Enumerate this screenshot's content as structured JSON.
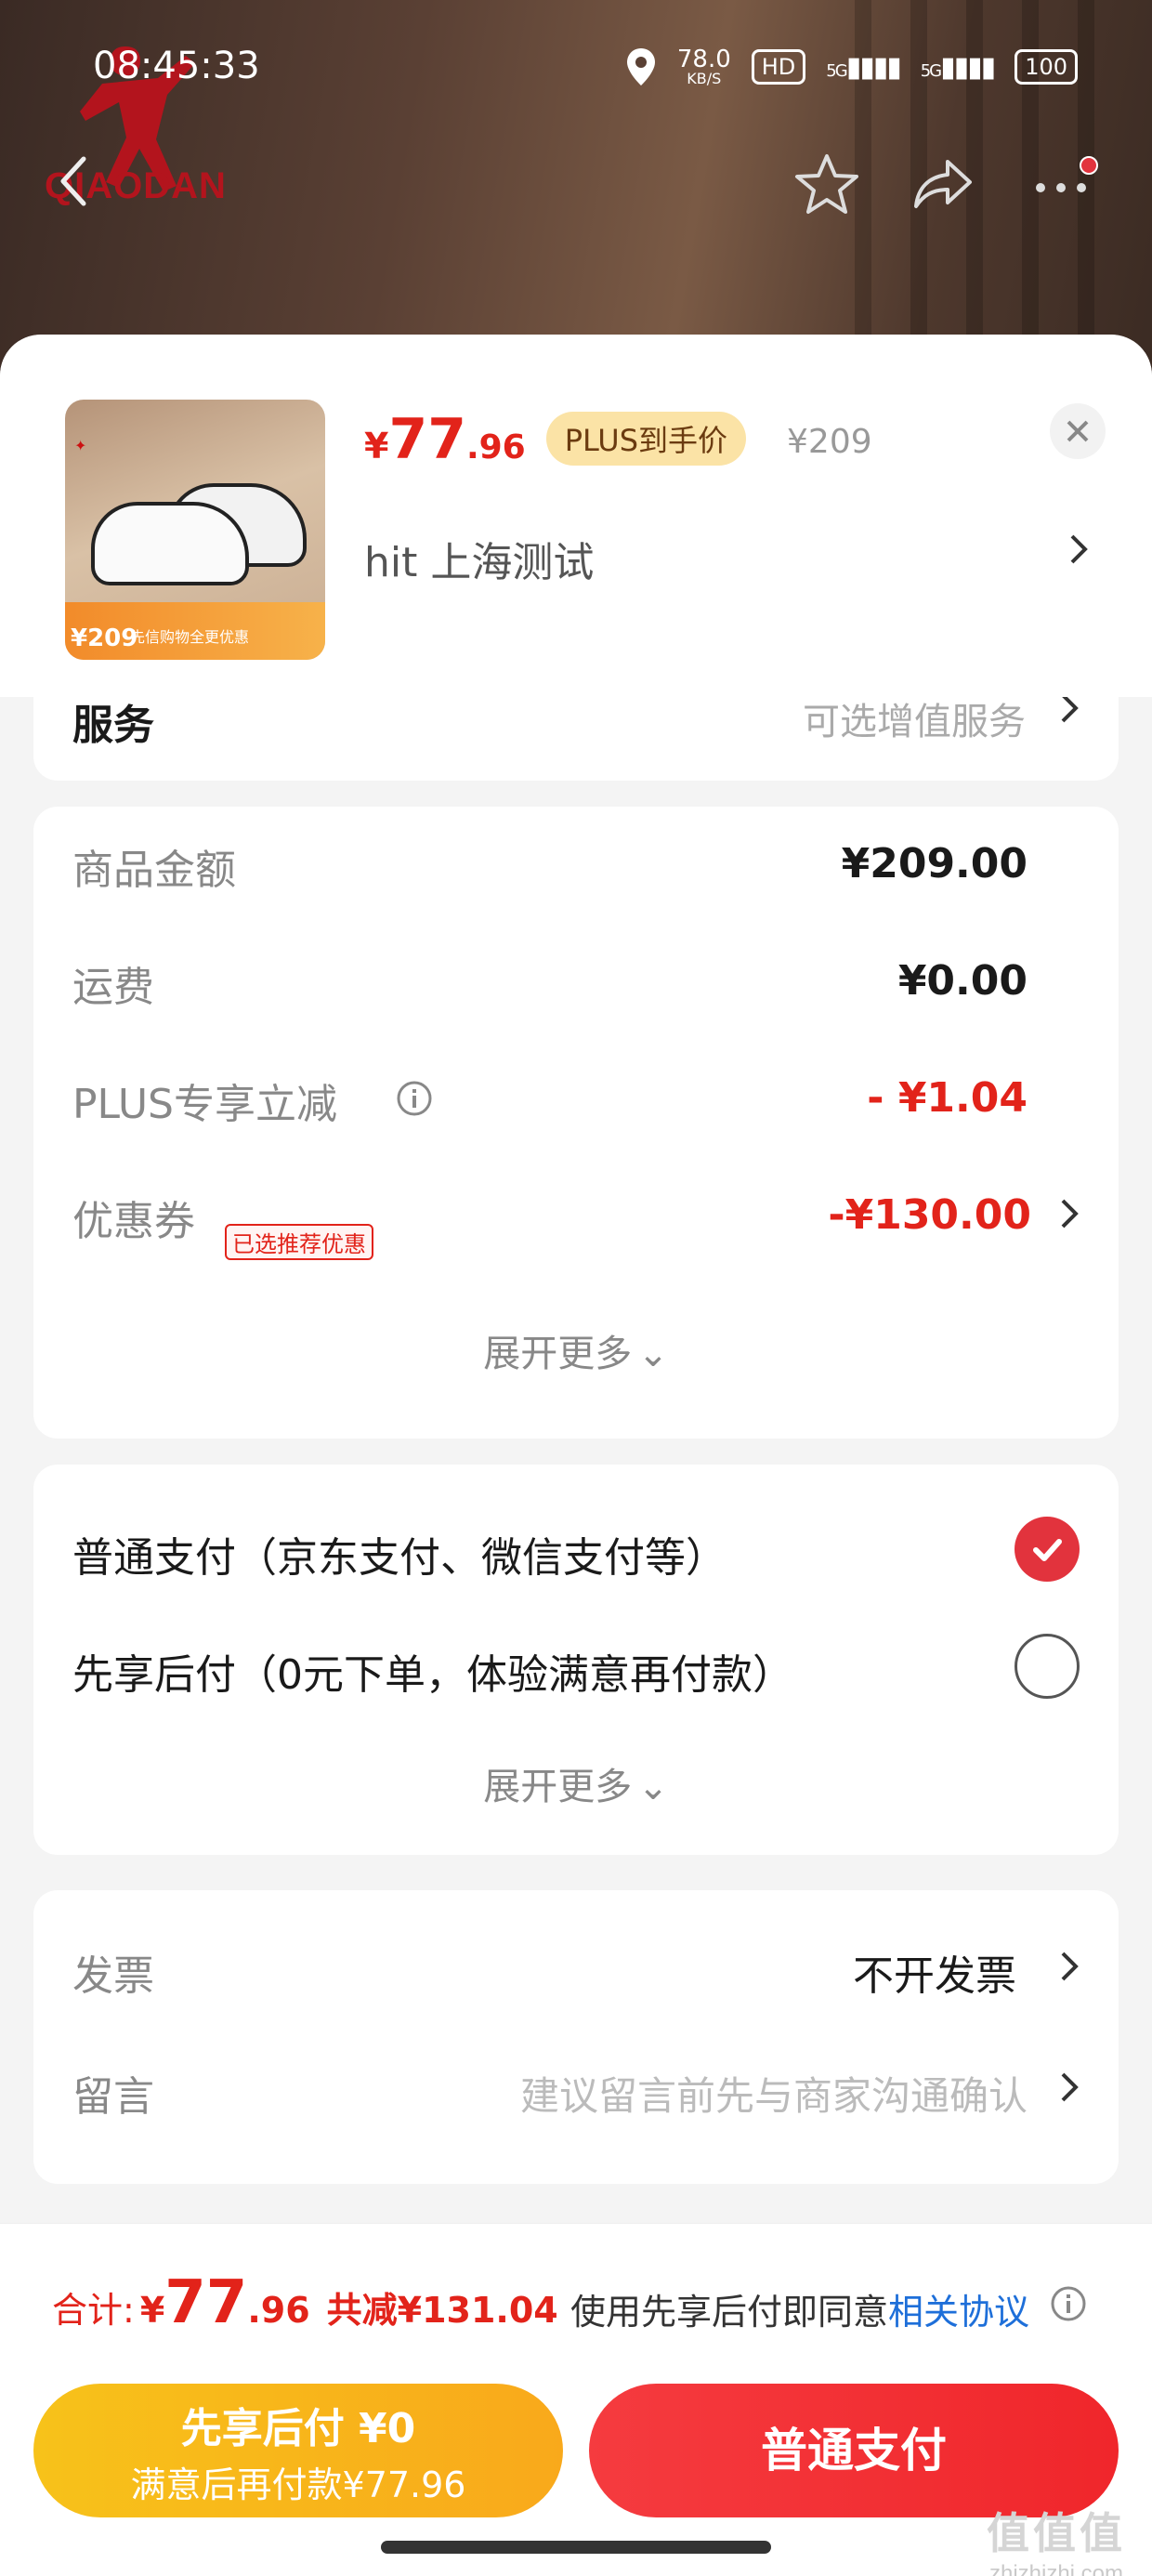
{
  "status_bar": {
    "time": "08:45:33",
    "net_speed": "78.0",
    "net_unit": "KB/S",
    "hd": "HD",
    "signal_1": "5G",
    "signal_2": "5G",
    "battery": "100"
  },
  "brand": {
    "logo_text": "QIAODAN"
  },
  "product": {
    "currency": "¥",
    "price_int": "77",
    "price_dec": ".96",
    "plus_badge": "PLUS到手价",
    "original_price": "¥209",
    "spec": "hit  上海测试",
    "thumb_price": "¥209",
    "thumb_banner": "先信购物全更优惠"
  },
  "service": {
    "label": "服务",
    "hint": "可选增值服务"
  },
  "amounts": {
    "goods_label": "商品金额",
    "goods_value": "¥209.00",
    "shipping_label": "运费",
    "shipping_value": "¥0.00",
    "plus_label": "PLUS专享立减",
    "plus_value": "- ¥1.04",
    "coupon_label": "优惠券",
    "coupon_tag": "已选推荐优惠",
    "coupon_value": "-¥130.00",
    "expand_label": "展开更多"
  },
  "payment": {
    "options": [
      {
        "label": "普通支付（京东支付、微信支付等）",
        "selected": true
      },
      {
        "label": "先享后付（0元下单，体验满意再付款）",
        "selected": false
      }
    ],
    "expand_label": "展开更多"
  },
  "misc": {
    "invoice_label": "发票",
    "invoice_value": "不开发票",
    "message_label": "留言",
    "message_placeholder": "建议留言前先与商家沟通确认"
  },
  "bottom": {
    "total_label": "合计:",
    "total_sym": "¥",
    "total_int": "77",
    "total_dec": ".96",
    "total_save": "共减¥131.04",
    "agree_text": "使用先享后付即同意",
    "agree_link": "相关协议",
    "btn_later_line1": "先享后付 ¥0",
    "btn_later_line2": "满意后再付款¥77.96",
    "btn_normal": "普通支付"
  },
  "watermark": {
    "line1": "值值值",
    "line2": "zhizhizhi.com"
  },
  "colors": {
    "accent_red": "#e2231a",
    "button_red": "#f0262b",
    "button_yellow": "#f9a91b",
    "link_blue": "#1e6fd9"
  }
}
